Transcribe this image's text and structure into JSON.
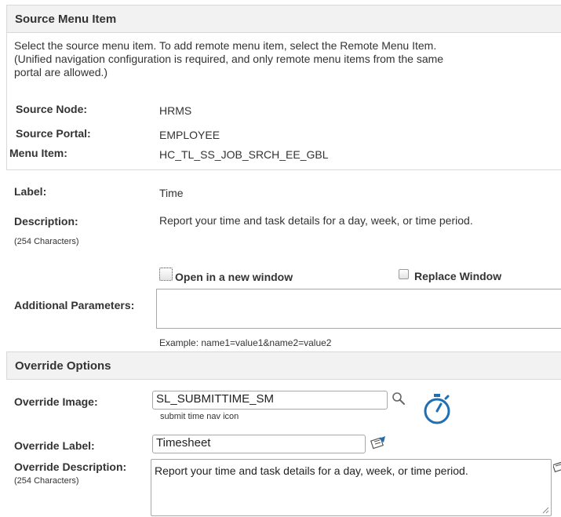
{
  "source_section": {
    "title": "Source Menu Item",
    "instructions_line1": "Select the source menu item. To add remote menu item, select the Remote Menu Item.",
    "instructions_line2": "(Unified navigation configuration is required, and only remote menu items from the same",
    "instructions_line3": "portal are allowed.)",
    "source_node_label": "Source Node:",
    "source_node_value": "HRMS",
    "source_portal_label": "Source Portal:",
    "source_portal_value": "EMPLOYEE",
    "menu_item_label": "Menu Item:",
    "menu_item_value": "HC_TL_SS_JOB_SRCH_EE_GBL"
  },
  "details": {
    "label_label": "Label:",
    "label_value": "Time",
    "description_label": "Description:",
    "description_hint": "(254 Characters)",
    "description_value": "Report your time and task details for a day, week, or time period.",
    "open_new_window_label": "Open in a new window",
    "open_new_window_checked": false,
    "replace_window_label": "Replace Window",
    "replace_window_checked": false,
    "additional_parameters_label": "Additional Parameters:",
    "additional_parameters_value": "",
    "additional_parameters_example": "Example: name1=value1&name2=value2"
  },
  "override_section": {
    "title": "Override Options",
    "override_image_label": "Override Image:",
    "override_image_value": "SL_SUBMITTIME_SM",
    "override_image_caption": "submit time nav icon",
    "override_label_label": "Override Label:",
    "override_label_value": "Timesheet",
    "override_description_label": "Override Description:",
    "override_description_hint": "(254 Characters)",
    "override_description_value": "Report your time and task details for a day, week, or time period."
  },
  "icons": {
    "search": "magnifier-icon",
    "preview": "stopwatch-icon",
    "translate": "translate-icon"
  },
  "colors": {
    "accent_blue": "#1f6fb2",
    "header_bg": "#f2f2f2",
    "border": "#d9d9d9"
  }
}
